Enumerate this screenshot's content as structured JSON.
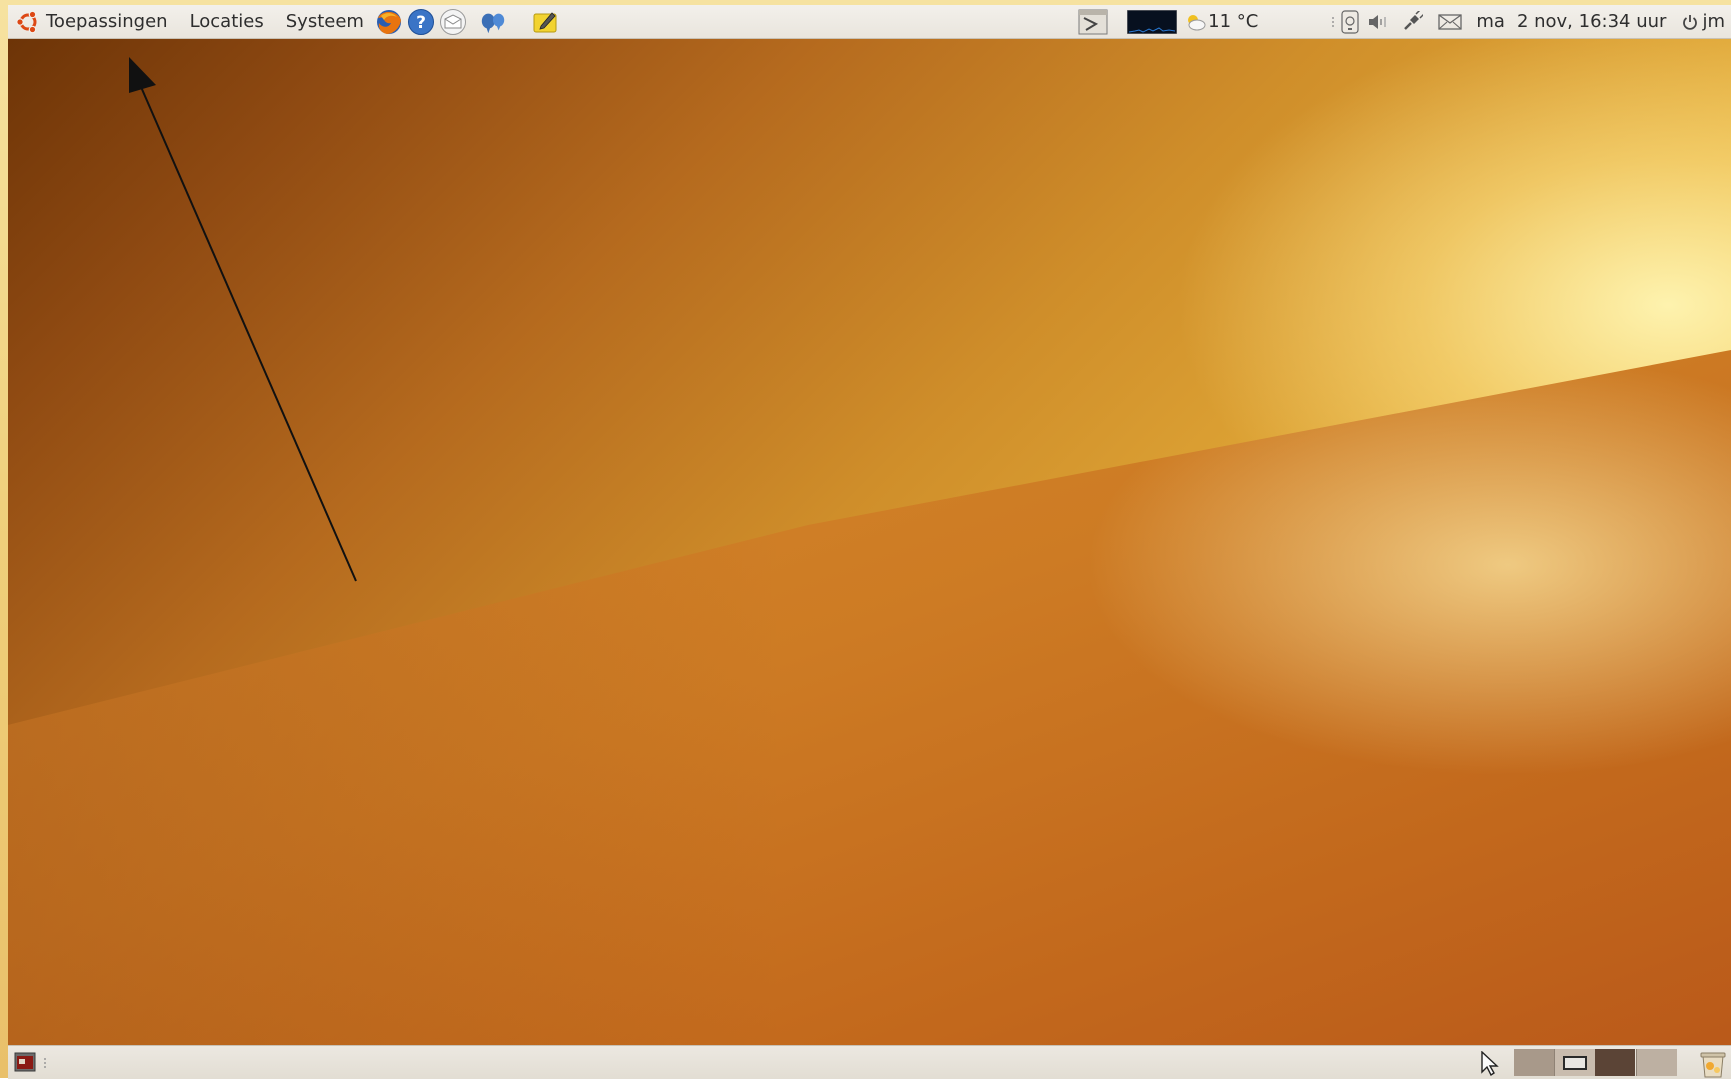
{
  "top_panel": {
    "menus": [
      {
        "label": "Toepassingen"
      },
      {
        "label": "Locaties"
      },
      {
        "label": "Systeem"
      }
    ],
    "launchers": [
      "firefox-icon",
      "help-icon",
      "mail-client-icon",
      "messenger-icon",
      "notes-icon"
    ],
    "weather": {
      "temperature": "11 °C"
    },
    "clock": {
      "day": "ma",
      "datetime": "2 nov, 16:34 uur"
    },
    "user": {
      "name": "jm"
    }
  },
  "bottom_panel": {
    "workspaces": 4,
    "active_workspace": 1
  },
  "colors": {
    "panel_bg": "#ece8e1",
    "wallpaper_dark": "#6a3206",
    "wallpaper_light": "#f7d86e",
    "ubuntu_orange": "#dd4814"
  }
}
